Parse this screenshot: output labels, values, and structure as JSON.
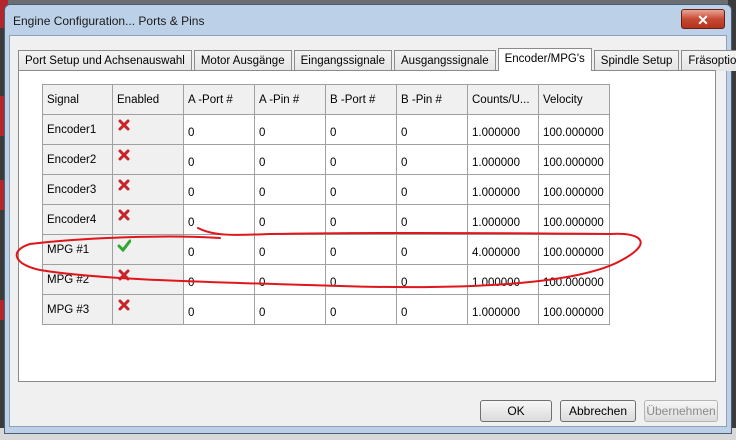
{
  "window": {
    "title": "Engine Configuration... Ports & Pins",
    "close_glyph": "✕"
  },
  "tabs": [
    {
      "label": "Port Setup und Achsenauswahl",
      "active": false
    },
    {
      "label": "Motor Ausgänge",
      "active": false
    },
    {
      "label": "Eingangssignale",
      "active": false
    },
    {
      "label": "Ausgangssignale",
      "active": false
    },
    {
      "label": "Encoder/MPG's",
      "active": true
    },
    {
      "label": "Spindle Setup",
      "active": false
    },
    {
      "label": "Fräsoptionen",
      "active": false
    }
  ],
  "grid": {
    "columns": [
      "Signal",
      "Enabled",
      "A -Port #",
      "A -Pin  #",
      "B -Port #",
      "B -Pin  #",
      "Counts/U...",
      "Velocity"
    ],
    "rows": [
      {
        "signal": "Encoder1",
        "enabled": false,
        "a_port": "0",
        "a_pin": "0",
        "b_port": "0",
        "b_pin": "0",
        "counts": "1.000000",
        "velocity": "100.000000"
      },
      {
        "signal": "Encoder2",
        "enabled": false,
        "a_port": "0",
        "a_pin": "0",
        "b_port": "0",
        "b_pin": "0",
        "counts": "1.000000",
        "velocity": "100.000000"
      },
      {
        "signal": "Encoder3",
        "enabled": false,
        "a_port": "0",
        "a_pin": "0",
        "b_port": "0",
        "b_pin": "0",
        "counts": "1.000000",
        "velocity": "100.000000"
      },
      {
        "signal": "Encoder4",
        "enabled": false,
        "a_port": "0",
        "a_pin": "0",
        "b_port": "0",
        "b_pin": "0",
        "counts": "1.000000",
        "velocity": "100.000000"
      },
      {
        "signal": "MPG #1",
        "enabled": true,
        "a_port": "0",
        "a_pin": "0",
        "b_port": "0",
        "b_pin": "0",
        "counts": "4.000000",
        "velocity": "100.000000"
      },
      {
        "signal": "MPG #2",
        "enabled": false,
        "a_port": "0",
        "a_pin": "0",
        "b_port": "0",
        "b_pin": "0",
        "counts": "1.000000",
        "velocity": "100.000000"
      },
      {
        "signal": "MPG #3",
        "enabled": false,
        "a_port": "0",
        "a_pin": "0",
        "b_port": "0",
        "b_pin": "0",
        "counts": "1.000000",
        "velocity": "100.000000"
      }
    ]
  },
  "buttons": {
    "ok": "OK",
    "cancel": "Abbrechen",
    "apply": "Übernehmen"
  },
  "colors": {
    "disabled_mark": "#c8222a",
    "enabled_mark": "#2fa82f",
    "annotation": "#e0161a"
  }
}
